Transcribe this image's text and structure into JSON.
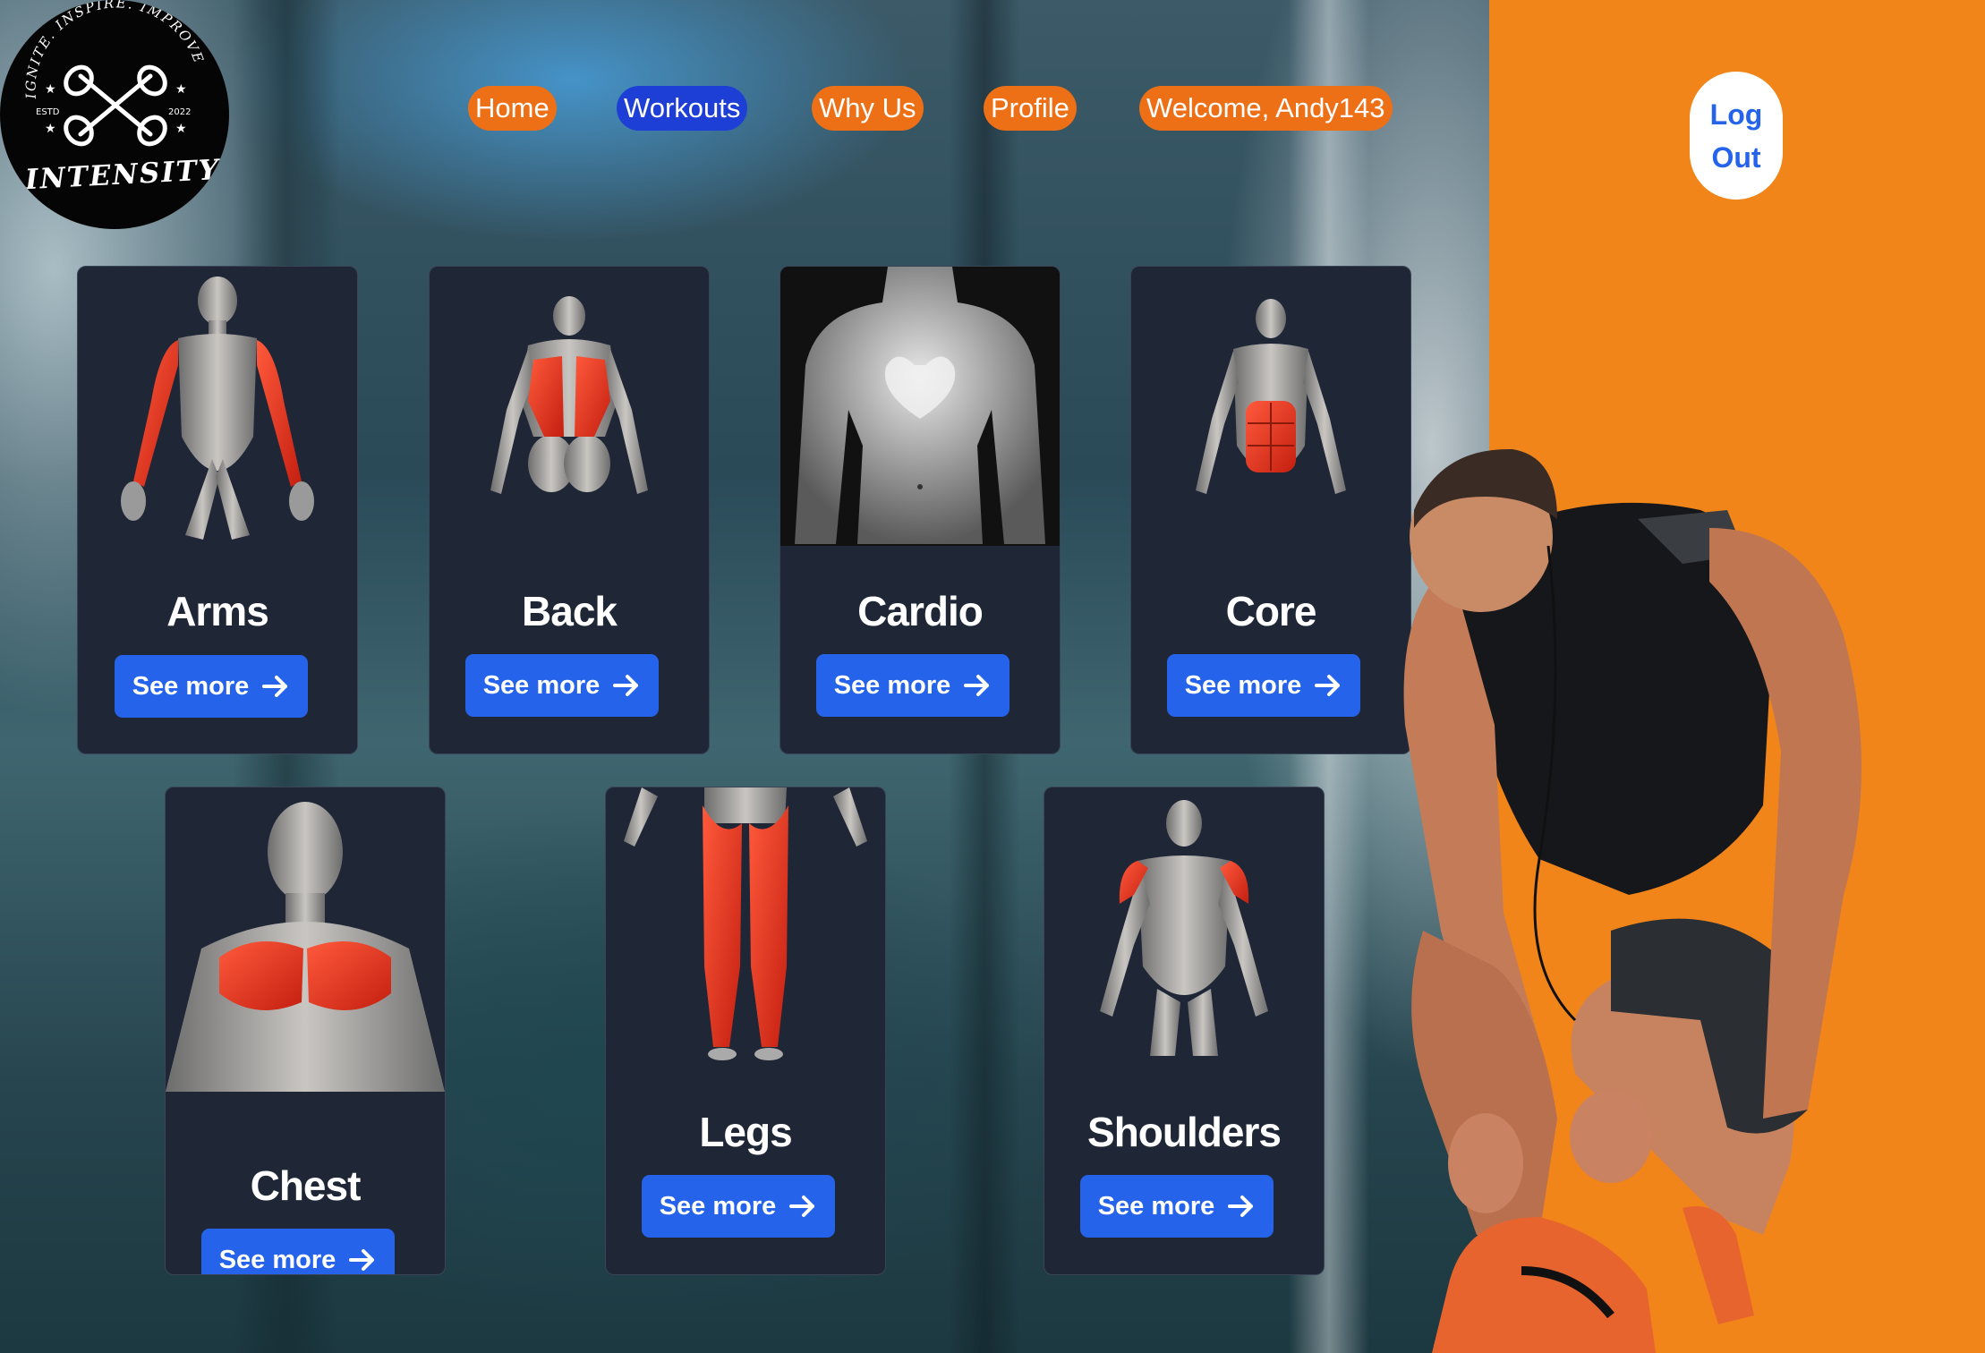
{
  "brand": {
    "name": "INTENSITY",
    "tagline": "IGNITE. INSPIRE. IMPROVE",
    "est_left": "ESTD",
    "est_right": "2022"
  },
  "nav": {
    "items": [
      {
        "label": "Home",
        "active": false
      },
      {
        "label": "Workouts",
        "active": true
      },
      {
        "label": "Why Us",
        "active": false
      },
      {
        "label": "Profile",
        "active": false
      },
      {
        "label": "Welcome, Andy143",
        "active": false
      }
    ],
    "logout_line1": "Log",
    "logout_line2": "Out"
  },
  "colors": {
    "nav_pill": "#EE7016",
    "nav_active": "#1D3FD6",
    "card_bg": "#1F2737",
    "button": "#2563EB",
    "side_panel": "#F18519",
    "muscle_highlight": "#E0361F"
  },
  "workouts": [
    {
      "title": "Arms",
      "button": "See more",
      "image": "arms-muscle-figure"
    },
    {
      "title": "Back",
      "button": "See more",
      "image": "back-muscle-figure"
    },
    {
      "title": "Cardio",
      "button": "See more",
      "image": "cardio-heart-torso"
    },
    {
      "title": "Core",
      "button": "See more",
      "image": "core-muscle-figure"
    },
    {
      "title": "Chest",
      "button": "See more",
      "image": "chest-muscle-figure"
    },
    {
      "title": "Legs",
      "button": "See more",
      "image": "legs-muscle-figure"
    },
    {
      "title": "Shoulders",
      "button": "See more",
      "image": "shoulders-muscle-figure"
    }
  ]
}
